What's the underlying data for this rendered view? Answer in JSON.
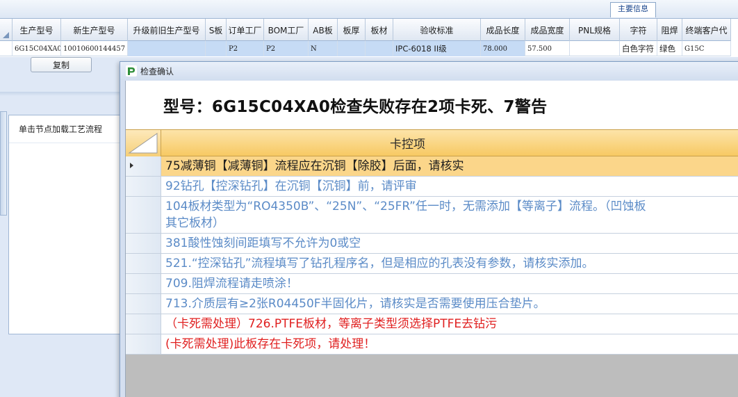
{
  "top_tab": {
    "label": "主要信息"
  },
  "grid": {
    "columns": [
      "生产型号",
      "新生产型号",
      "升级前旧生产型号",
      "S板",
      "订单工厂",
      "BOM工厂",
      "AB板",
      "板厚",
      "板材",
      "验收标准",
      "成品长度",
      "成品宽度",
      "PNL规格",
      "字符",
      "阻焊",
      "终端客户代"
    ],
    "row": [
      "6G15C04XA0",
      "10010600144457",
      "",
      "",
      "P2",
      "P2",
      "N",
      "",
      "",
      "IPC-6018 II级",
      "78.000",
      "57.500",
      "",
      "白色字符",
      "绿色",
      "G15C"
    ]
  },
  "copy_button": {
    "label": "复制"
  },
  "flow_panel": {
    "label": "单击节点加载工艺流程"
  },
  "dialog": {
    "title": "检查确认",
    "headline": "型号：6G15C04XA0检查失败存在2项卡死、7警告",
    "column_header": "卡控项",
    "items": [
      {
        "text": "75减薄铜【减薄铜】流程应在沉铜【除胶】后面，请核实",
        "style": "active"
      },
      {
        "text": "92钻孔【控深钻孔】在沉铜【沉铜】前，请评审",
        "style": "warn"
      },
      {
        "text": "104板材类型为“RO4350B”、“25N”、“25FR”任一时，无需添加【等离子】流程。（凹蚀板\n其它板材）",
        "style": "warn"
      },
      {
        "text": "381酸性蚀刻间距填写不允许为0或空",
        "style": "warn"
      },
      {
        "text": "521.“控深钻孔”流程填写了钻孔程序名，但是相应的孔表没有参数，请核实添加。",
        "style": "warn"
      },
      {
        "text": "709.阻焊流程请走喷涂！",
        "style": "warn"
      },
      {
        "text": "713.介质层有≥2张R04450F半固化片，请核实是否需要使用压合垫片。",
        "style": "warn"
      },
      {
        "text": "（卡死需处理）726.PTFE板材，等离子类型须选择PTFE去钻污",
        "style": "red"
      },
      {
        "text": "(卡死需处理)此板存在卡死项，请处理！",
        "style": "red"
      }
    ]
  },
  "colors": {
    "warn": "#5b8bc7",
    "red": "#e02020",
    "active_row": "#fbd68a",
    "header": "#f7c963"
  }
}
